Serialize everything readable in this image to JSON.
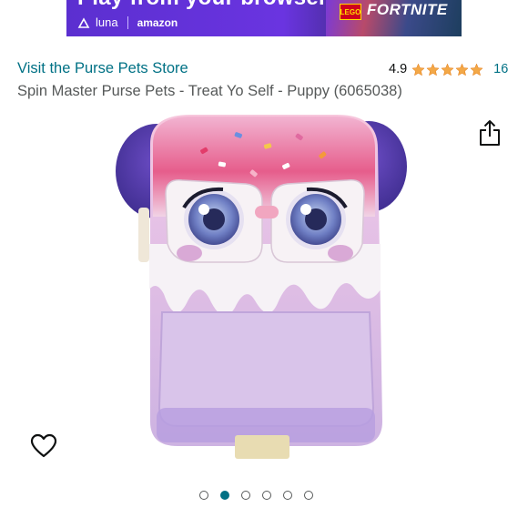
{
  "ad_banner": {
    "headline": "Play from your browser",
    "brand_luna": "luna",
    "brand_amazon": "amazon",
    "game_lego": "LEGO",
    "game_title": "FORTNITE",
    "background": "#6a34e0"
  },
  "store": {
    "link_label": "Visit the Purse Pets Store"
  },
  "rating": {
    "value": "4.9",
    "stars": 5,
    "count": "16",
    "star_color": "#F3A847"
  },
  "product": {
    "title": "Spin Master Purse Pets - Treat Yo Self - Puppy (6065038)"
  },
  "actions": {
    "share_icon": "share-icon",
    "wishlist_icon": "heart-icon"
  },
  "carousel": {
    "total": 6,
    "active_index": 1,
    "accent": "#007185"
  }
}
